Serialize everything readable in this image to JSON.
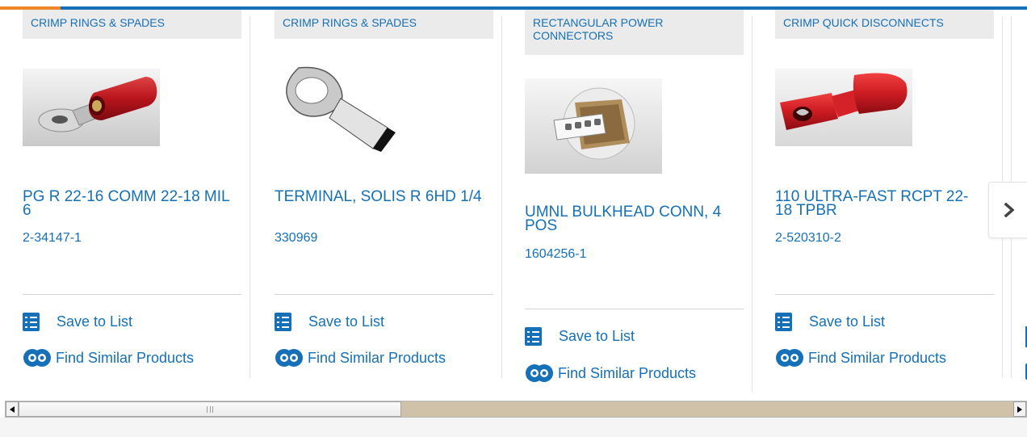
{
  "colors": {
    "brand_blue": "#1570b8",
    "accent_orange": "#f0862a"
  },
  "products": [
    {
      "category": "CRIMP RINGS & SPADES",
      "title": "PG R 22-16 COMM 22-18 MIL 6",
      "part_number": "2-34147-1",
      "save_label": "Save to List",
      "similar_label": "Find Similar Products",
      "image": "red-ring-terminal"
    },
    {
      "category": "CRIMP RINGS & SPADES",
      "title": "TERMINAL, SOLIS R 6HD 1/4",
      "part_number": "330969",
      "save_label": "Save to List",
      "similar_label": "Find Similar Products",
      "image": "silver-ring-terminal"
    },
    {
      "category": "RECTANGULAR POWER CONNECTORS",
      "title": "UMNL BULKHEAD CONN, 4 POS",
      "part_number": "1604256-1",
      "save_label": "Save to List",
      "similar_label": "Find Similar Products",
      "image": "bulkhead-connector"
    },
    {
      "category": "CRIMP QUICK DISCONNECTS",
      "title": "110 ULTRA-FAST RCPT 22-18 TPBR",
      "part_number": "2-520310-2",
      "save_label": "Save to List",
      "similar_label": "Find Similar Products",
      "image": "red-quick-disconnect"
    }
  ],
  "icons": {
    "save": "checklist-icon",
    "similar": "gear-search-icon",
    "next": "chevron-right-icon"
  }
}
